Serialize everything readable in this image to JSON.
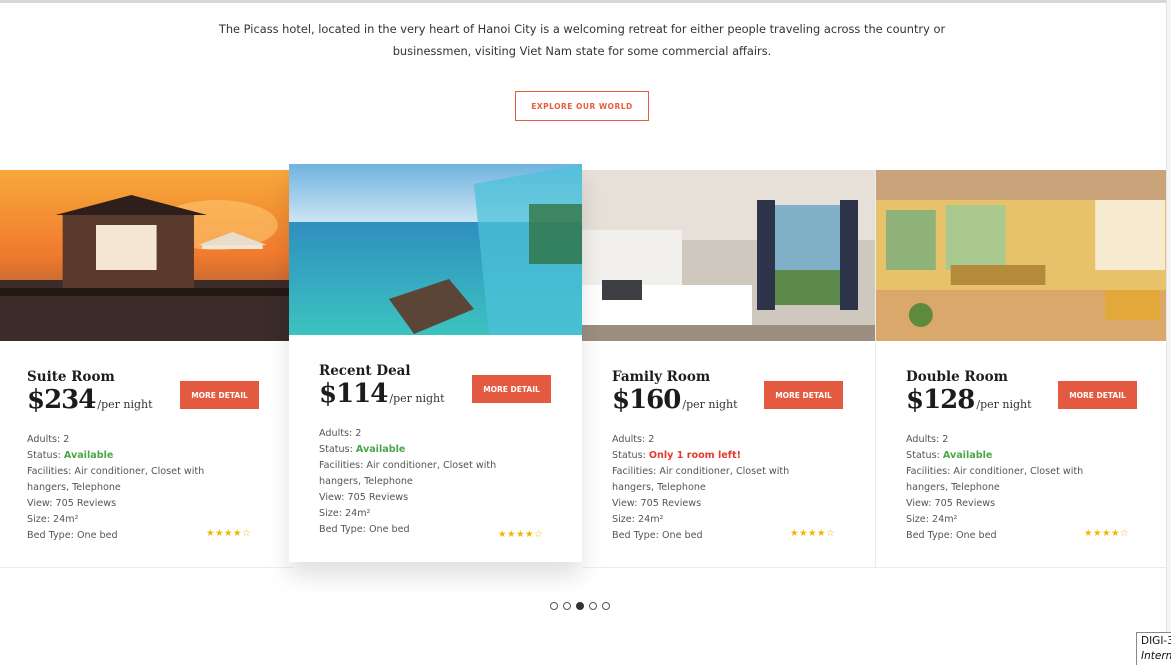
{
  "intro": {
    "line1": "The Picass hotel, located in the very heart of Hanoi City is a welcoming retreat for either people traveling across the country or",
    "line2": "businessmen, visiting Viet Nam state for some commercial affairs.",
    "cta_label": "EXPLORE OUR WORLD"
  },
  "labels": {
    "adults": "Adults:",
    "status": "Status:",
    "facilities": "Facilities:",
    "view": "View:",
    "size": "Size:",
    "bed_type": "Bed Type:",
    "per_night": "/per night",
    "more_detail": "MORE DETAIL"
  },
  "rooms": [
    {
      "name": "Suite Room",
      "price": "$234",
      "adults": "2",
      "status": "Available",
      "status_color": "#4aa64a",
      "facilities_1": "Air conditioner, Closet with",
      "facilities_2": "hangers, Telephone",
      "view": "705 Reviews",
      "size": "24m²",
      "bed_type": "One bed",
      "rating": 4,
      "stars": "★★★★",
      "empty_star": "☆",
      "photo": "overwater-bungalow-sunset"
    },
    {
      "name": "Recent Deal",
      "price": "$114",
      "adults": "2",
      "status": "Available",
      "status_color": "#4aa64a",
      "facilities_1": "Air conditioner, Closet with",
      "facilities_2": "hangers, Telephone",
      "view": "705 Reviews",
      "size": "24m²",
      "bed_type": "One bed",
      "rating": 4,
      "stars": "★★★★",
      "empty_star": "☆",
      "photo": "sea-view-balcony"
    },
    {
      "name": "Family Room",
      "price": "$160",
      "adults": "2",
      "status": "Only 1 room left!",
      "status_color": "#e13a2e",
      "facilities_1": "Air conditioner, Closet with",
      "facilities_2": "hangers, Telephone",
      "view": "705 Reviews",
      "size": "24m²",
      "bed_type": "One bed",
      "rating": 4,
      "stars": "★★★★",
      "empty_star": "☆",
      "photo": "bedroom-sea-view"
    },
    {
      "name": "Double Room",
      "price": "$128",
      "adults": "2",
      "status": "Available",
      "status_color": "#4aa64a",
      "facilities_1": "Air conditioner, Closet with",
      "facilities_2": "hangers, Telephone",
      "view": "705 Reviews",
      "size": "24m²",
      "bed_type": "One bed",
      "rating": 4,
      "stars": "★★★★",
      "empty_star": "☆",
      "photo": "yellow-living-room"
    }
  ],
  "pagination": {
    "count": 5,
    "active_index": 2
  },
  "tooltip": {
    "line1": "DIGI-3",
    "line2": "Intern"
  },
  "colors": {
    "accent": "#e35a41",
    "available": "#4aa64a",
    "limited": "#e13a2e",
    "star": "#f2b600"
  }
}
